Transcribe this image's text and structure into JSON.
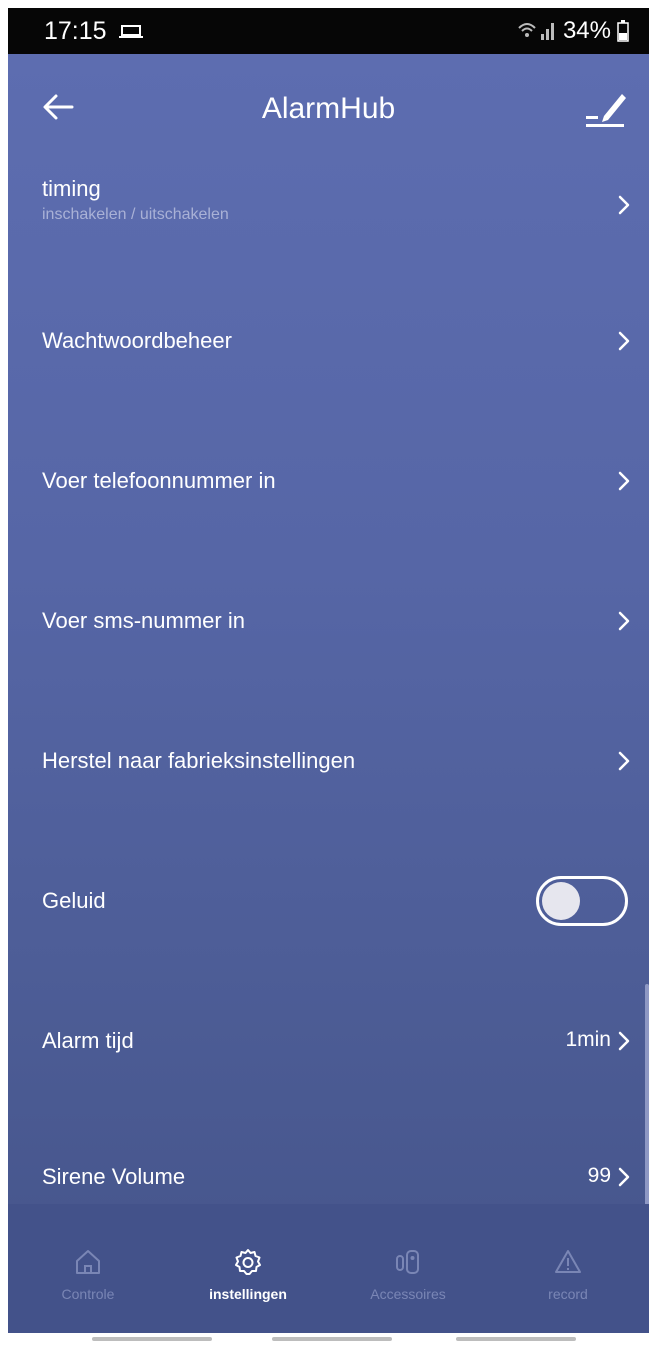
{
  "status_bar": {
    "time": "17:15",
    "battery": "34%"
  },
  "app_bar": {
    "title": "AlarmHub"
  },
  "settings": {
    "timing": {
      "label": "timing",
      "sublabel": "inschakelen / uitschakelen"
    },
    "password": {
      "label": "Wachtwoordbeheer"
    },
    "phone": {
      "label": "Voer telefoonnummer in"
    },
    "sms": {
      "label": "Voer sms-nummer in"
    },
    "reset": {
      "label": "Herstel naar fabrieksinstellingen"
    },
    "sound": {
      "label": "Geluid",
      "enabled": false
    },
    "alarm_time": {
      "label": "Alarm tijd",
      "value": "1min"
    },
    "siren_volume": {
      "label": "Sirene Volume",
      "value": "99"
    }
  },
  "tabs": [
    {
      "label": "Controle",
      "icon": "home-icon",
      "active": false
    },
    {
      "label": "instellingen",
      "icon": "gear-icon",
      "active": true
    },
    {
      "label": "Accessoires",
      "icon": "sensor-icon",
      "active": false
    },
    {
      "label": "record",
      "icon": "warning-icon",
      "active": false
    }
  ],
  "colors": {
    "header": "#5d6db0",
    "background_bottom": "#45548a",
    "tab_bar": "#43528a",
    "text": "#ffffff",
    "muted_text": "#a9b1d6"
  }
}
